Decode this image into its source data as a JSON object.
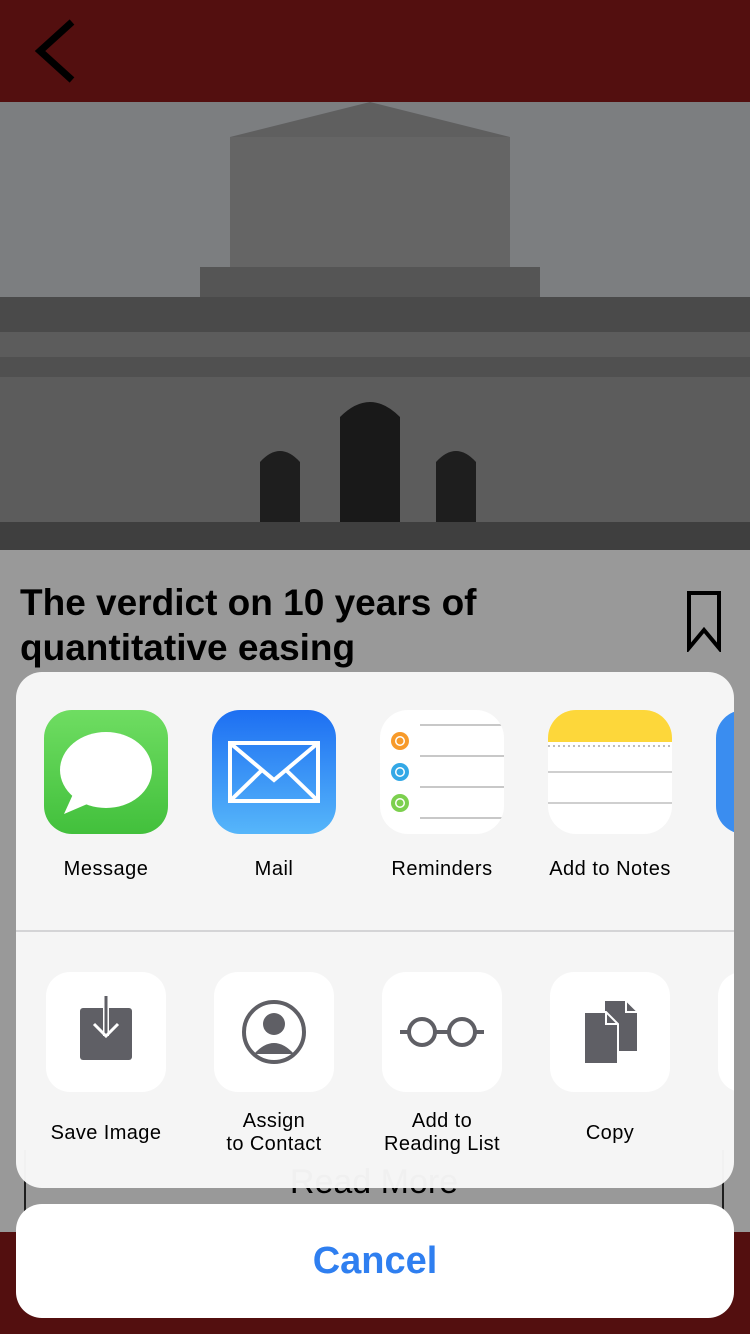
{
  "article": {
    "title": "The verdict on 10 years of quantitative easing",
    "read_more": "Read More"
  },
  "share_sheet": {
    "apps": [
      {
        "label": "Message",
        "icon": "messages-app-icon"
      },
      {
        "label": "Mail",
        "icon": "mail-app-icon"
      },
      {
        "label": "Reminders",
        "icon": "reminders-app-icon"
      },
      {
        "label": "Add to Notes",
        "icon": "notes-app-icon"
      }
    ],
    "actions": [
      {
        "label": "Save Image",
        "icon": "save-image-icon"
      },
      {
        "line1": "Assign",
        "line2": "to Contact",
        "icon": "contact-icon"
      },
      {
        "line1": "Add to",
        "line2": "Reading List",
        "icon": "reading-list-icon"
      },
      {
        "label": "Copy",
        "icon": "copy-icon"
      }
    ],
    "cancel": "Cancel"
  },
  "colors": {
    "brand_red": "#8b1a1a",
    "cancel_blue": "#2f7ff0"
  }
}
